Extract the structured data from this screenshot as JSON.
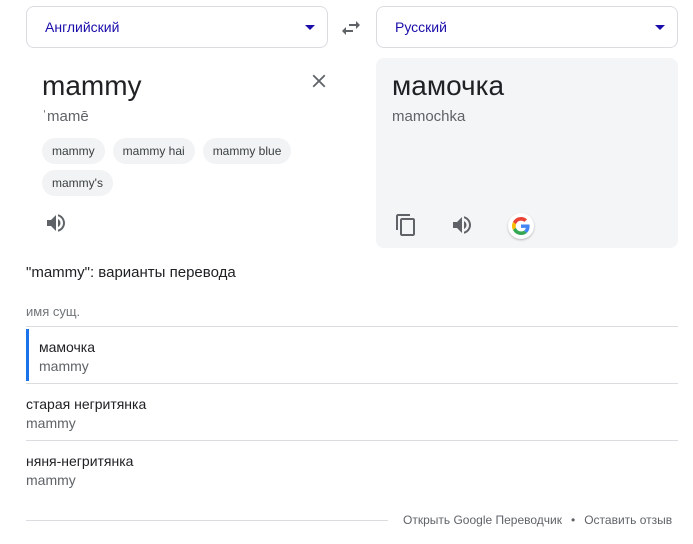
{
  "languages": {
    "source": "Английский",
    "target": "Русский"
  },
  "source": {
    "word": "mammy",
    "phonetic": "ˈmamē",
    "suggestions": [
      "mammy",
      "mammy hai",
      "mammy blue",
      "mammy's"
    ]
  },
  "target": {
    "word": "мамочка",
    "transliteration": "mamochka"
  },
  "variants": {
    "title": "\"mammy\": варианты перевода",
    "part_of_speech": "имя сущ.",
    "items": [
      {
        "word": "мамочка",
        "back": "mammy"
      },
      {
        "word": "старая негритянка",
        "back": "mammy"
      },
      {
        "word": "няня-негритянка",
        "back": "mammy"
      }
    ]
  },
  "footer": {
    "open_link": "Открыть Google Переводчик",
    "separator": "•",
    "feedback_link": "Оставить отзыв"
  },
  "colors": {
    "accent_blue": "#1a73e8",
    "link_blue": "#1a0dab"
  }
}
